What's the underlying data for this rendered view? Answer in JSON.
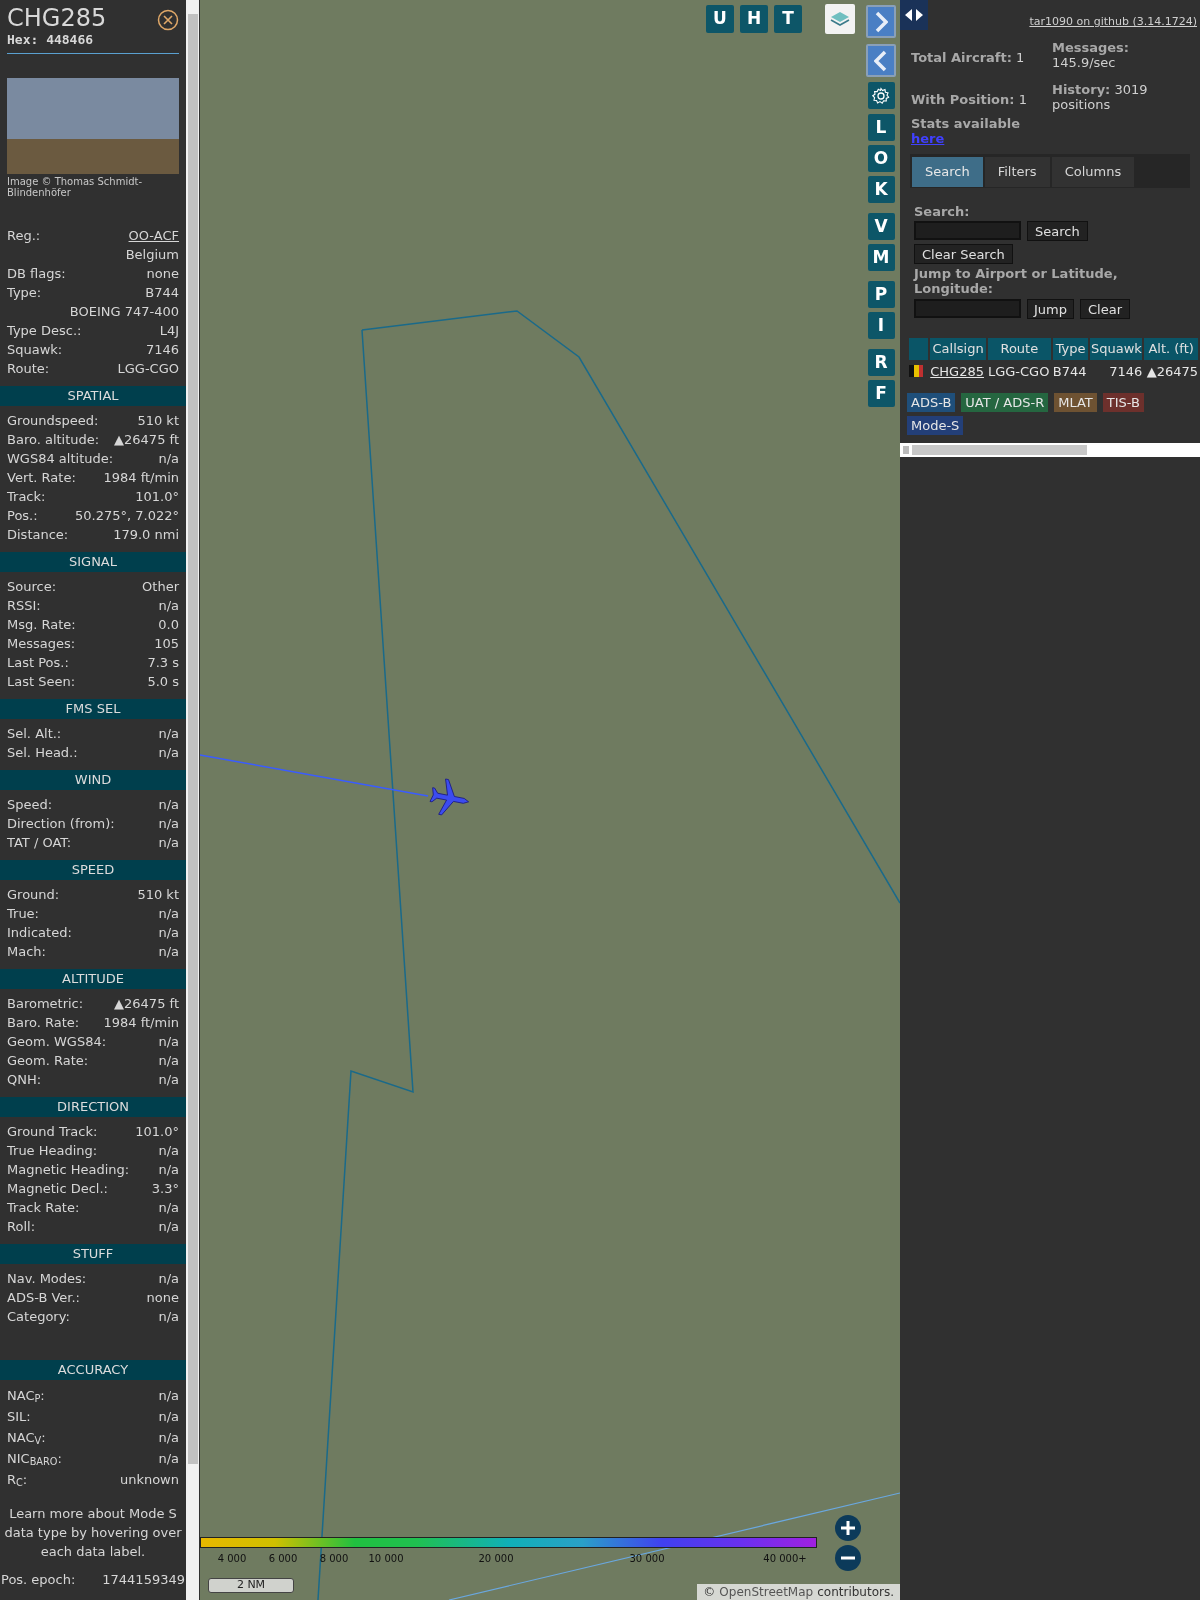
{
  "aircraft_panel": {
    "callsign": "CHG285",
    "hex": "Hex: 448466",
    "photo_caption": "Image © Thomas Schmidt-Blindenhöfer",
    "info_rows": [
      {
        "label": "Reg.:",
        "value": "OO-ACF",
        "link": true
      },
      {
        "value": "Belgium",
        "link": false
      },
      {
        "label": "DB flags:",
        "value": "none",
        "link": false
      },
      {
        "label": "Type:",
        "value": "B744",
        "link": false
      },
      {
        "value": "BOEING 747-400",
        "link": false
      },
      {
        "label": "Type Desc.:",
        "value": "L4J",
        "link": false
      },
      {
        "label": "Squawk:",
        "value": "7146",
        "link": false
      },
      {
        "label": "Route:",
        "value": "LGG-CGO",
        "link": false
      }
    ],
    "sections": [
      {
        "title": "SPATIAL",
        "rows": [
          {
            "label": "Groundspeed:",
            "value": "510 kt"
          },
          {
            "label": "Baro. altitude:",
            "value": "▲26475 ft"
          },
          {
            "label": "WGS84 altitude:",
            "value": "n/a"
          },
          {
            "label": "Vert. Rate:",
            "value": "1984 ft/min"
          },
          {
            "label": "Track:",
            "value": "101.0°"
          },
          {
            "label": "Pos.:",
            "value": "50.275°, 7.022°"
          },
          {
            "label": "Distance:",
            "value": "179.0 nmi"
          }
        ]
      },
      {
        "title": "SIGNAL",
        "rows": [
          {
            "label": "Source:",
            "value": "Other"
          },
          {
            "label": "RSSI:",
            "value": "n/a"
          },
          {
            "label": "Msg. Rate:",
            "value": "0.0"
          },
          {
            "label": "Messages:",
            "value": "105"
          },
          {
            "label": "Last Pos.:",
            "value": "7.3 s"
          },
          {
            "label": "Last Seen:",
            "value": "5.0 s"
          }
        ]
      },
      {
        "title": "FMS SEL",
        "rows": [
          {
            "label": "Sel. Alt.:",
            "value": "n/a"
          },
          {
            "label": "Sel. Head.:",
            "value": "n/a"
          }
        ]
      },
      {
        "title": "WIND",
        "rows": [
          {
            "label": "Speed:",
            "value": "n/a"
          },
          {
            "label": "Direction (from):",
            "value": "n/a"
          },
          {
            "label": "TAT / OAT:",
            "value": "n/a"
          }
        ]
      },
      {
        "title": "SPEED",
        "rows": [
          {
            "label": "Ground:",
            "value": "510 kt"
          },
          {
            "label": "True:",
            "value": "n/a"
          },
          {
            "label": "Indicated:",
            "value": "n/a"
          },
          {
            "label": "Mach:",
            "value": "n/a"
          }
        ]
      },
      {
        "title": "ALTITUDE",
        "rows": [
          {
            "label": "Barometric:",
            "value": "▲26475 ft"
          },
          {
            "label": "Baro. Rate:",
            "value": "1984 ft/min"
          },
          {
            "label": "Geom. WGS84:",
            "value": "n/a"
          },
          {
            "label": "Geom. Rate:",
            "value": "n/a"
          },
          {
            "label": "QNH:",
            "value": "n/a"
          }
        ]
      },
      {
        "title": "DIRECTION",
        "rows": [
          {
            "label": "Ground Track:",
            "value": "101.0°"
          },
          {
            "label": "True Heading:",
            "value": "n/a"
          },
          {
            "label": "Magnetic Heading:",
            "value": "n/a"
          },
          {
            "label": "Magnetic Decl.:",
            "value": "3.3°"
          },
          {
            "label": "Track Rate:",
            "value": "n/a"
          },
          {
            "label": "Roll:",
            "value": "n/a"
          }
        ]
      },
      {
        "title": "STUFF",
        "rows": [
          {
            "label": "Nav. Modes:",
            "value": "n/a"
          },
          {
            "label": "ADS-B Ver.:",
            "value": "none"
          },
          {
            "label": "Category:",
            "value": "n/a"
          }
        ]
      },
      {
        "title": "ACCURACY",
        "rows": [
          {
            "label": "NAC$_{P}$:",
            "value": "n/a"
          },
          {
            "label": "SIL:",
            "value": "n/a"
          },
          {
            "label": "NAC$_{V}$:",
            "value": "n/a"
          },
          {
            "label": "NIC$_{BARO}$:",
            "value": "n/a"
          },
          {
            "label": "R$_{C}$:",
            "value": "unknown"
          }
        ]
      }
    ],
    "note": "Learn more about Mode S data type by hovering over each data label.",
    "epoch": {
      "label": "Pos. epoch:",
      "value": "1744159349"
    }
  },
  "map": {
    "top_buttons": [
      "U",
      "H",
      "T"
    ],
    "side_button_groups": [
      [
        "L",
        "O",
        "K"
      ],
      [
        "V",
        "M"
      ],
      [
        "P",
        "I"
      ],
      [
        "R",
        "F"
      ]
    ],
    "altitude_legend": [
      "4 000",
      "6 000",
      "8 000",
      "10 000",
      "20 000",
      "30 000",
      "40 000+"
    ],
    "scale": "2 NM",
    "attribution": {
      "prefix": "©",
      "link": "OpenStreetMap",
      "suffix": "contributors."
    }
  },
  "side_panel": {
    "github_link": "tar1090 on github (3.14.1724)",
    "stats": [
      {
        "label": "Total Aircraft:",
        "value": "1"
      },
      {
        "label": "Messages:",
        "value": "145.9/sec"
      },
      {
        "label": "With Position:",
        "value": "1"
      },
      {
        "label": "History:",
        "value": "3019 positions"
      }
    ],
    "stats_note": {
      "text": "Stats available",
      "link": "here"
    },
    "tabs": [
      {
        "label": "Search",
        "selected": true
      },
      {
        "label": "Filters",
        "selected": false
      },
      {
        "label": "Columns",
        "selected": false
      }
    ],
    "search": {
      "label": "Search:",
      "button": "Search",
      "clear_button": "Clear Search"
    },
    "jump": {
      "label": "Jump to Airport or Latitude, Longitude:",
      "button": "Jump",
      "clear_button": "Clear"
    },
    "table": {
      "columns": [
        "Callsign",
        "Route",
        "Type",
        "Squawk",
        "Alt. (ft)"
      ],
      "rows": [
        {
          "callsign": "CHG285",
          "route": "LGG-CGO",
          "type": "B744",
          "squawk": "7146",
          "altitude": "▲26475"
        }
      ]
    },
    "legend": [
      {
        "label": "ADS-B",
        "color": "#1f4f7a"
      },
      {
        "label": "UAT / ADS-R",
        "color": "#256640"
      },
      {
        "label": "MLAT",
        "color": "#6e5232"
      },
      {
        "label": "TIS-B",
        "color": "#6d302c"
      },
      {
        "label": "Mode-S",
        "color": "#233f78"
      }
    ]
  }
}
